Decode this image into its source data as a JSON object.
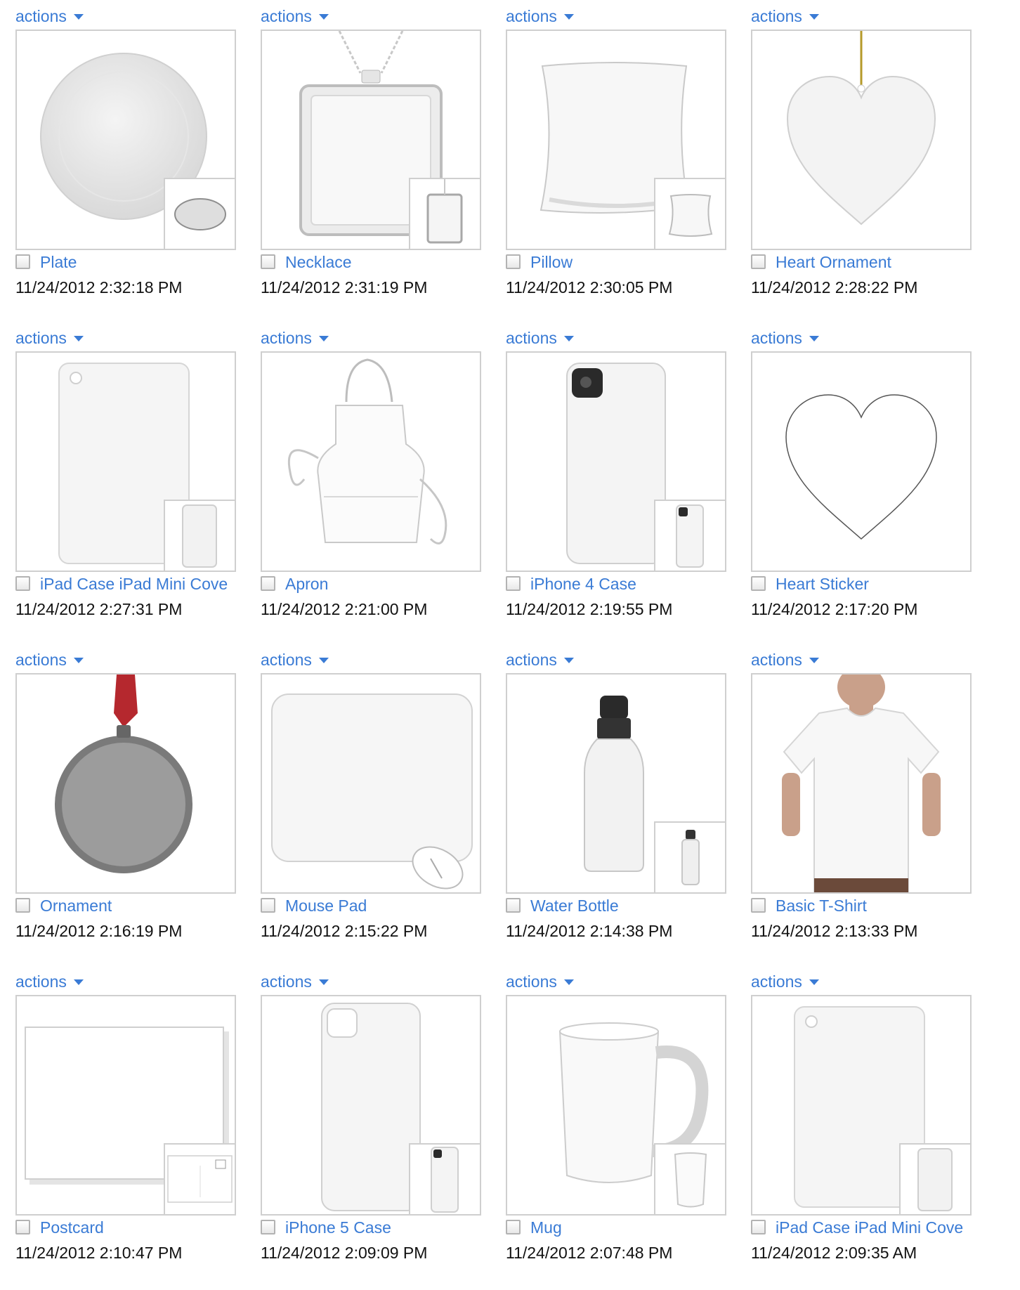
{
  "actions_label": "actions",
  "products": [
    {
      "name": "Plate",
      "date": "11/24/2012 2:32:18 PM",
      "icon": "plate-icon"
    },
    {
      "name": "Necklace",
      "date": "11/24/2012 2:31:19 PM",
      "icon": "necklace-icon"
    },
    {
      "name": "Pillow",
      "date": "11/24/2012 2:30:05 PM",
      "icon": "pillow-icon"
    },
    {
      "name": "Heart Ornament",
      "date": "11/24/2012 2:28:22 PM",
      "icon": "heart-ornament-icon"
    },
    {
      "name": "iPad Case iPad Mini Cove",
      "date": "11/24/2012 2:27:31 PM",
      "icon": "ipad-case-icon"
    },
    {
      "name": "Apron",
      "date": "11/24/2012 2:21:00 PM",
      "icon": "apron-icon"
    },
    {
      "name": "iPhone 4 Case",
      "date": "11/24/2012 2:19:55 PM",
      "icon": "iphone4-case-icon"
    },
    {
      "name": "Heart Sticker",
      "date": "11/24/2012 2:17:20 PM",
      "icon": "heart-sticker-icon"
    },
    {
      "name": "Ornament",
      "date": "11/24/2012 2:16:19 PM",
      "icon": "ornament-icon"
    },
    {
      "name": "Mouse Pad",
      "date": "11/24/2012 2:15:22 PM",
      "icon": "mouse-pad-icon"
    },
    {
      "name": "Water Bottle",
      "date": "11/24/2012 2:14:38 PM",
      "icon": "water-bottle-icon"
    },
    {
      "name": "Basic T-Shirt",
      "date": "11/24/2012 2:13:33 PM",
      "icon": "tshirt-icon"
    },
    {
      "name": "Postcard",
      "date": "11/24/2012 2:10:47 PM",
      "icon": "postcard-icon"
    },
    {
      "name": "iPhone 5 Case",
      "date": "11/24/2012 2:09:09 PM",
      "icon": "iphone5-case-icon"
    },
    {
      "name": "Mug",
      "date": "11/24/2012 2:07:48 PM",
      "icon": "mug-icon"
    },
    {
      "name": "iPad Case iPad Mini Cove",
      "date": "11/24/2012 2:09:35 AM",
      "icon": "ipad-case-icon"
    }
  ],
  "colors": {
    "link": "#3a7bd5",
    "border": "#cfcfcf",
    "text": "#111111",
    "ribbon": "#b5282e",
    "ornament_gray": "#9c9c9c"
  }
}
